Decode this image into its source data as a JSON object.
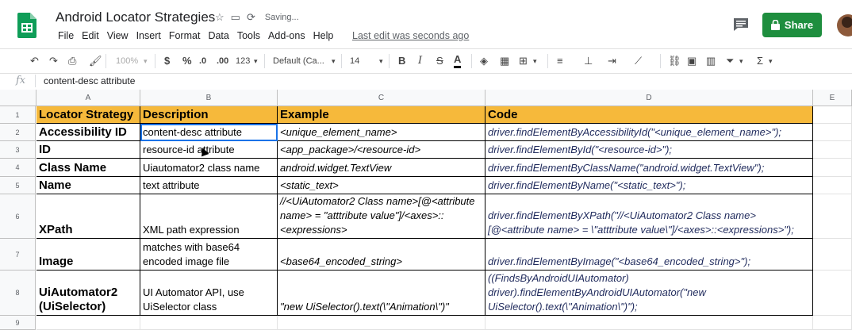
{
  "app": {
    "title": "Android Locator Strategies",
    "saving": "Saving...",
    "last_edit": "Last edit was seconds ago",
    "share_label": "Share",
    "accent": "#1e8e3e"
  },
  "menu": [
    "File",
    "Edit",
    "View",
    "Insert",
    "Format",
    "Data",
    "Tools",
    "Add-ons",
    "Help"
  ],
  "toolbar": {
    "zoom": "100%",
    "currency": "$",
    "percent": "%",
    "dec_less": ".0",
    "dec_more": ".00",
    "more_formats": "123",
    "font": "Default (Ca...",
    "font_size": "14",
    "bold": "B",
    "italic": "I",
    "strike": "S",
    "text_color": "A"
  },
  "formula_bar": {
    "fx": "fx",
    "value": "content-desc attribute"
  },
  "columns": [
    "A",
    "B",
    "C",
    "D",
    "E"
  ],
  "rows": [
    "1",
    "2",
    "3",
    "4",
    "5",
    "6",
    "7",
    "8",
    "9"
  ],
  "header_color": "#f6b93b",
  "table": {
    "headers": [
      "Locator Strategy",
      "Description",
      "Example",
      "Code"
    ],
    "rows": [
      {
        "strategy": "Accessibility ID",
        "description": "content-desc attribute",
        "example": "<unique_element_name>",
        "code": "driver.findElementByAccessibilityId(\"<unique_element_name>\");"
      },
      {
        "strategy": "ID",
        "description": "resource-id attribute",
        "example": "<app_package>/<resource-id>",
        "code": "driver.findElementById(\"<resource-id>\");"
      },
      {
        "strategy": "Class Name",
        "description": "Uiautomator2 class name",
        "example": "android.widget.TextView",
        "code": "driver.findElementByClassName(\"android.widget.TextView\");"
      },
      {
        "strategy": "Name",
        "description": "text attribute",
        "example": "<static_text>",
        "code": "driver.findElementByName(\"<static_text>\");"
      },
      {
        "strategy": "XPath",
        "description": "XML path expression",
        "example": "//<UiAutomator2 Class name>[@<attribute name> = \"atttribute value\"]/<axes>::<expressions>",
        "code": "driver.findElementByXPath(\"//<UiAutomator2 Class name>[@<attribute name> = \\\"atttribute value\\\"]/<axes>::<expressions>\");"
      },
      {
        "strategy": "Image",
        "description": "matches with base64 encoded image file",
        "example": "<base64_encoded_string>",
        "code": "driver.findElementByImage(\"<base64_encoded_string>\");"
      },
      {
        "strategy": "UiAutomator2 (UiSelector)",
        "description": "UI Automator API, use UiSelector class",
        "example": "\"new UiSelector().text(\\\"Animation\\\")\"",
        "code": "((FindsByAndroidUIAutomator) driver).findElementByAndroidUIAutomator(\"new UiSelector().text(\\\"Animation\\\")\");"
      }
    ]
  }
}
